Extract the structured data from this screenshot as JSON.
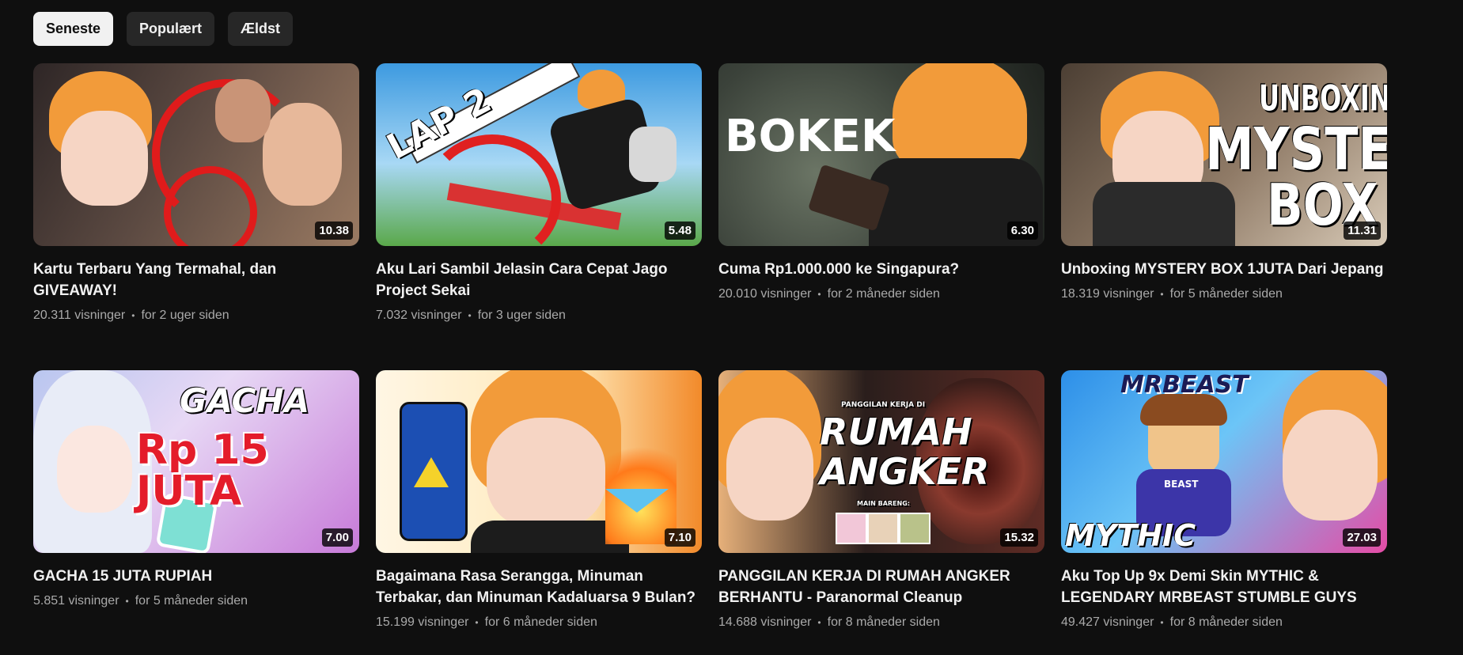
{
  "filters": [
    {
      "label": "Seneste",
      "active": true
    },
    {
      "label": "Populært",
      "active": false
    },
    {
      "label": "Ældst",
      "active": false
    }
  ],
  "videos": [
    {
      "title": "Kartu Terbaru Yang Termahal, dan GIVEAWAY!",
      "views": "20.311 visninger",
      "age": "for 2 uger siden",
      "duration": "10.38",
      "thumb_colors": [
        "#3a3030",
        "#8a6a55"
      ]
    },
    {
      "title": "Aku Lari Sambil Jelasin Cara Cepat Jago Project Sekai",
      "views": "7.032 visninger",
      "age": "for 3 uger siden",
      "duration": "5.48",
      "thumb_text": "LAP 2",
      "thumb_colors": [
        "#4aa8e8",
        "#bfe3f7"
      ]
    },
    {
      "title": "Cuma Rp1.000.000 ke Singapura?",
      "views": "20.010 visninger",
      "age": "for 2 måneder siden",
      "duration": "6.30",
      "thumb_text": "BOKEK",
      "thumb_colors": [
        "#2b2f2b",
        "#5a6356"
      ]
    },
    {
      "title": "Unboxing MYSTERY BOX 1JUTA Dari Jepang",
      "views": "18.319 visninger",
      "age": "for 5 måneder siden",
      "duration": "11.31",
      "thumb_text_lines": [
        "UNBOXING",
        "MYSTERY",
        "BOX"
      ],
      "thumb_colors": [
        "#6b5a4b",
        "#c9b9a5"
      ]
    },
    {
      "title": "GACHA 15 JUTA RUPIAH",
      "views": "5.851 visninger",
      "age": "for 5 måneder siden",
      "duration": "7.00",
      "thumb_text_lines": [
        "GACHA",
        "Rp 15 JUTA"
      ],
      "thumb_colors": [
        "#a7b8e8",
        "#e7d6f2"
      ]
    },
    {
      "title": "Bagaimana Rasa Serangga, Minuman Terbakar, dan Minuman Kadaluarsa 9 Bulan?",
      "views": "15.199 visninger",
      "age": "for 6 måneder siden",
      "duration": "7.10",
      "thumb_colors": [
        "#fff3d6",
        "#f5b34a"
      ]
    },
    {
      "title": "PANGGILAN KERJA DI RUMAH ANGKER BERHANTU - Paranormal Cleanup",
      "views": "14.688 visninger",
      "age": "for 8 måneder siden",
      "duration": "15.32",
      "thumb_text_lines": [
        "PANGGILAN KERJA DI",
        "RUMAH",
        "ANGKER",
        "MAIN BARENG:"
      ],
      "thumb_colors": [
        "#1a1414",
        "#5c2a22"
      ]
    },
    {
      "title": "Aku Top Up 9x Demi Skin MYTHIC & LEGENDARY MRBEAST STUMBLE GUYS",
      "views": "49.427 visninger",
      "age": "for 8 måneder siden",
      "duration": "27.03",
      "thumb_text_lines": [
        "MRBEAST",
        "MYTHIC",
        "BEAST"
      ],
      "thumb_colors": [
        "#3fa9f5",
        "#e64fa8"
      ]
    }
  ]
}
